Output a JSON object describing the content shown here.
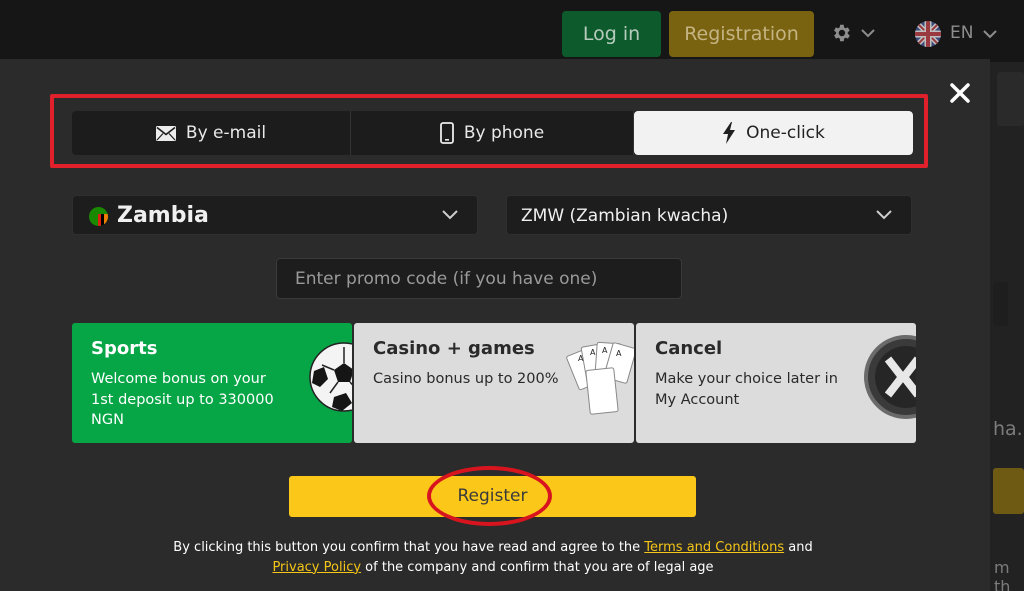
{
  "header": {
    "login_label": "Log in",
    "registration_label": "Registration",
    "language": "EN"
  },
  "background": {
    "snippet_1": "ha.",
    "snippet_2": "m th"
  },
  "tabs": [
    {
      "label": "By e-mail",
      "icon": "envelope-icon",
      "active": false
    },
    {
      "label": "By phone",
      "icon": "phone-icon",
      "active": false
    },
    {
      "label": "One-click",
      "icon": "lightning-icon",
      "active": true
    }
  ],
  "form": {
    "country": "Zambia",
    "currency": "ZMW (Zambian kwacha)",
    "promo_placeholder": "Enter promo code (if you have one)"
  },
  "bonuses": [
    {
      "title": "Sports",
      "description": "Welcome bonus on your 1st deposit up to 330000 NGN",
      "icon": "soccer-ball-icon"
    },
    {
      "title": "Casino + games",
      "description": "Casino bonus up to 200%",
      "icon": "playing-cards-icon"
    },
    {
      "title": "Cancel",
      "description": "Make your choice later in My Account",
      "icon": "cancel-x-icon"
    }
  ],
  "register_label": "Register",
  "legal": {
    "part1": "By clicking this button you confirm that you have read and agree to the ",
    "terms_link": "Terms and Conditions",
    "part2": " and ",
    "privacy_link": "Privacy Policy",
    "part3": " of the company and confirm that you are of legal age"
  },
  "colors": {
    "accent_yellow": "#fbc81a",
    "sports_green": "#06a546",
    "highlight_red": "#e0202a",
    "link": "#f5c518"
  }
}
